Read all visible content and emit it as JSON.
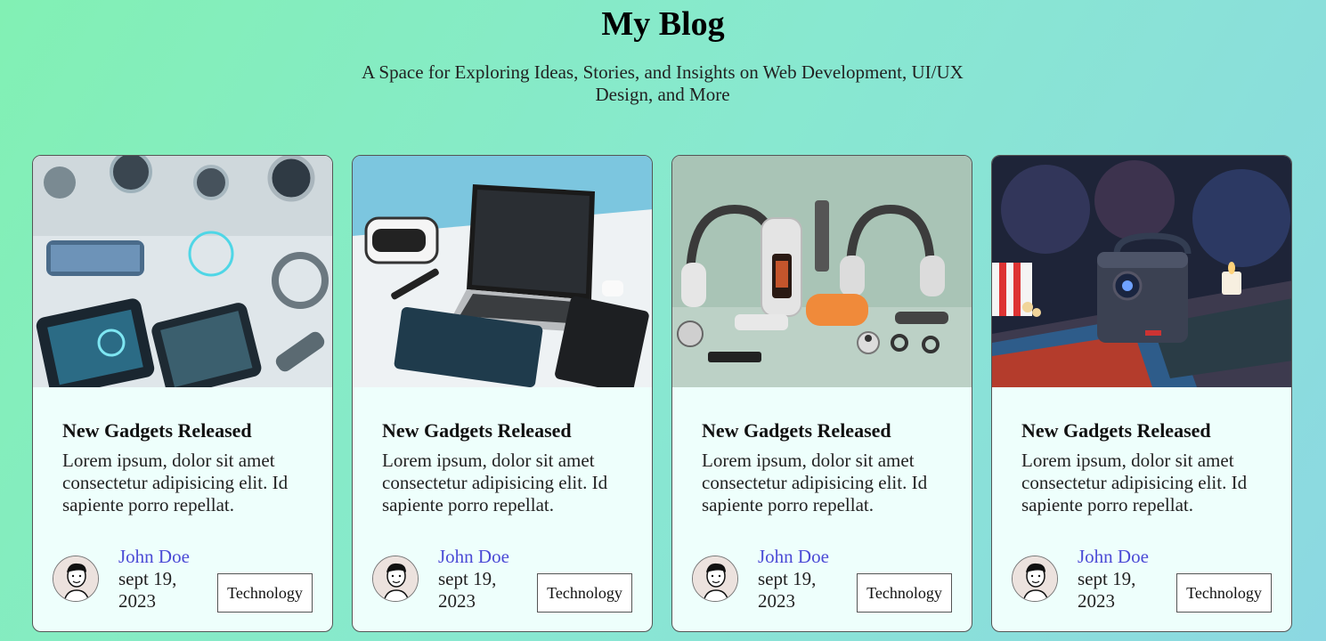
{
  "header": {
    "title": "My Blog",
    "subtitle": "A Space for Exploring Ideas, Stories, and Insights on Web Development, UI/UX Design, and More"
  },
  "cards": [
    {
      "image_icon": "gadgets-flatlay-image",
      "title": "New Gadgets Released",
      "text": "Lorem ipsum, dolor sit amet consectetur adipisicing elit. Id sapiente porro repellat.",
      "author": "John Doe",
      "date": "sept 19, 2023",
      "tag": "Technology"
    },
    {
      "image_icon": "laptop-desk-image",
      "title": "New Gadgets Released",
      "text": "Lorem ipsum, dolor sit amet consectetur adipisicing elit. Id sapiente porro repellat.",
      "author": "John Doe",
      "date": "sept 19, 2023",
      "tag": "Technology"
    },
    {
      "image_icon": "headphones-image",
      "title": "New Gadgets Released",
      "text": "Lorem ipsum, dolor sit amet consectetur adipisicing elit. Id sapiente porro repellat.",
      "author": "John Doe",
      "date": "sept 19, 2023",
      "tag": "Technology"
    },
    {
      "image_icon": "projector-image",
      "title": "New Gadgets Released",
      "text": "Lorem ipsum, dolor sit amet consectetur adipisicing elit. Id sapiente porro repellat.",
      "author": "John Doe",
      "date": "sept 19, 2023",
      "tag": "Technology"
    }
  ],
  "colors": {
    "background_start": "#82f0b4",
    "background_end": "#8cd8e2",
    "card_background": "#eefffc",
    "author_link": "#4b4bd6"
  }
}
